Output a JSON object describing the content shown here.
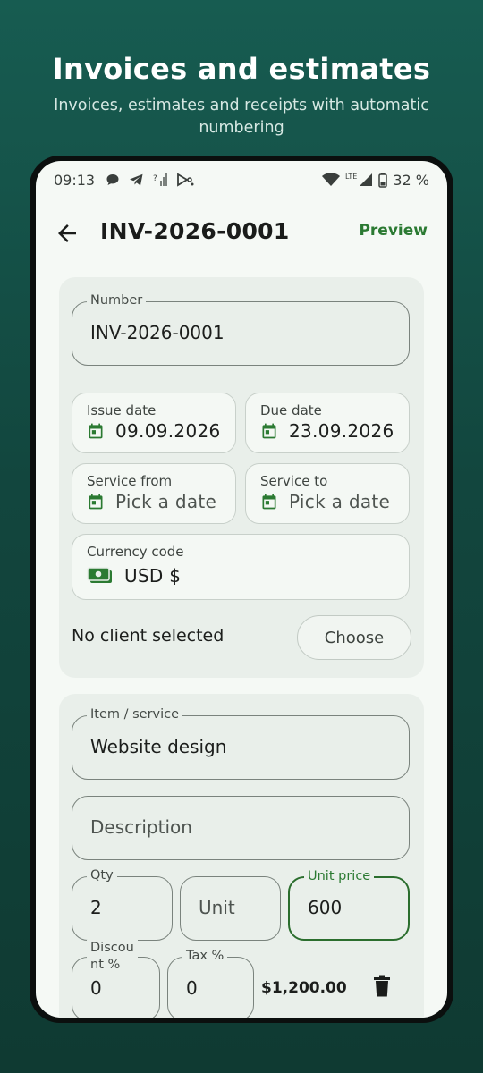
{
  "promo": {
    "title": "Invoices and estimates",
    "subtitle": "Invoices, estimates and receipts with automatic numbering"
  },
  "status_bar": {
    "time": "09:13",
    "battery": "32 %",
    "network": "LTE"
  },
  "app_bar": {
    "title": "INV-2026-0001",
    "preview_label": "Preview"
  },
  "invoice": {
    "number_label": "Number",
    "number_value": "INV-2026-0001",
    "issue_date_label": "Issue date",
    "issue_date_value": "09.09.2026",
    "due_date_label": "Due date",
    "due_date_value": "23.09.2026",
    "service_from_label": "Service from",
    "service_from_value": "Pick a date",
    "service_to_label": "Service to",
    "service_to_value": "Pick a date",
    "currency_label": "Currency code",
    "currency_value": "USD  $",
    "client_text": "No client selected",
    "choose_label": "Choose"
  },
  "item": {
    "item_label": "Item / service",
    "item_value": "Website design",
    "description_placeholder": "Description",
    "qty_label": "Qty",
    "qty_value": "2",
    "unit_placeholder": "Unit",
    "unit_price_label": "Unit price",
    "unit_price_value": "600",
    "discount_label_1": "Discou",
    "discount_label_2": "nt %",
    "discount_value": "0",
    "tax_label": "Tax %",
    "tax_value": "0",
    "line_total": "$1,200.00"
  },
  "colors": {
    "accent": "#2b7a32",
    "background_top": "#175c51",
    "background_bottom": "#0f3a32",
    "screen": "#f5f9f5",
    "card": "#e9efea"
  },
  "icons": [
    "back-arrow-icon",
    "calendar-icon",
    "money-icon",
    "trash-icon",
    "wifi-icon",
    "signal-icon",
    "battery-icon",
    "chat-icon",
    "telegram-icon",
    "cast-icon"
  ]
}
